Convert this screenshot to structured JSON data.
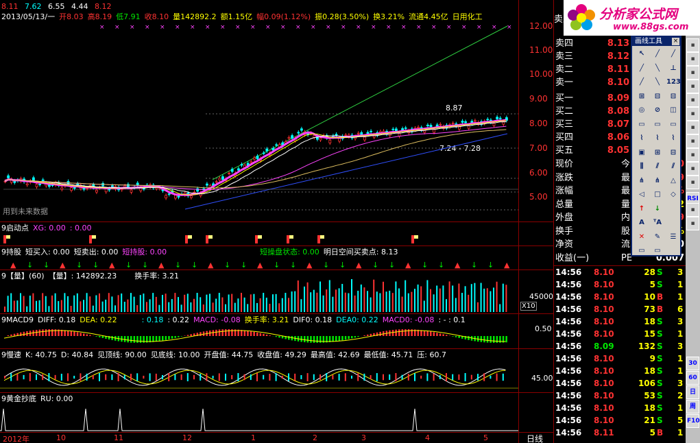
{
  "info_bar": {
    "date": "2013/05/13/一",
    "open": "开8.03",
    "high": "高8.19",
    "low": "低7.91",
    "close": "收8.10",
    "volume": "量142892.2",
    "amount": "额1.15亿",
    "range": "幅0.09(1.12%)",
    "amplitude": "振0.28(3.50%)",
    "turnover": "换3.21%",
    "float": "流通4.45亿",
    "industry": "日用化工"
  },
  "ma_row": {
    "v1": "8.11",
    "v2": "7.62",
    "v3": "6.55",
    "v4": "4.44",
    "v5": "8.12"
  },
  "price_axis": [
    "12.00",
    "11.00",
    "10.00",
    "9.00",
    "8.00",
    "7.00",
    "6.00",
    "5.00"
  ],
  "main_chart": {
    "warn": "用到未来数据",
    "high_label": "8.87",
    "range_label": "7.24 - 7.28"
  },
  "panels": {
    "p1": {
      "title": "9启动点",
      "a": "XG: 0.00",
      "b": ": 0.00"
    },
    "p2": {
      "title": "9持股",
      "a": "短买入: 0.00",
      "b": "短卖出: 0.00",
      "c": "短持股: 0.00",
      "d": "短操盘状态: 0.00",
      "e": "明日空间买卖点: 8.13"
    },
    "p3": {
      "title": "9【量】(60)",
      "a": "【量】: 142892.23",
      "b": "换手率: 3.21",
      "axis": "45000",
      "x": "X10"
    },
    "p4": {
      "title": "9MACD9",
      "a": "DIFF: 0.18",
      "b": "DEA: 0.22",
      "c": ": 0.18",
      "d": ": 0.22",
      "e": "MACD: -0.08",
      "f": "换手率: 3.21",
      "g": "DIF0: 0.18",
      "h": "DEA0: 0.22",
      "i": "MACD0: -0.08",
      "j": ": - : 0.1",
      "axis": "0.50"
    },
    "p5": {
      "title": "9慢速",
      "a": "K: 40.75",
      "b": "D: 40.84",
      "c": "见顶线: 90.00",
      "d": "见底线: 10.00",
      "e": "开盘值: 44.75",
      "f": "收盘值: 49.29",
      "g": "最高值: 42.69",
      "h": "最低值: 45.71",
      "i": "压: 60.7",
      "axis": "45.00"
    },
    "p6": {
      "title": "9黄金抄底",
      "a": "RU: 0.00"
    }
  },
  "time_axis": [
    "2012年",
    "10",
    "11",
    "12",
    "1",
    "2",
    "3",
    "4",
    "5"
  ],
  "period": "日线",
  "orderbook": {
    "asks": [
      [
        "卖五",
        ""
      ],
      [
        "卖四",
        "8.13"
      ],
      [
        "卖三",
        "8.12"
      ],
      [
        "卖二",
        "8.11"
      ],
      [
        "卖一",
        "8.10"
      ]
    ],
    "bids": [
      [
        "买一",
        "8.09"
      ],
      [
        "买二",
        "8.08"
      ],
      [
        "买三",
        "8.07"
      ],
      [
        "买四",
        "8.06"
      ],
      [
        "买五",
        "8.05"
      ]
    ],
    "stats": [
      [
        "现价",
        "8.10",
        "今"
      ],
      [
        "涨跌",
        "0.09",
        "最"
      ],
      [
        "涨幅",
        "1.12%",
        "最"
      ],
      [
        "总量",
        "142892",
        "量"
      ],
      [
        "外盘",
        "73409",
        "内"
      ],
      [
        "换手",
        "3.21%",
        "股"
      ],
      [
        "净资",
        "2.30",
        "流"
      ],
      [
        "收益(一)",
        "0.007",
        "PE"
      ]
    ]
  },
  "ticks": [
    [
      "14:56",
      "8.10",
      "28",
      "S",
      "3"
    ],
    [
      "14:56",
      "8.10",
      "5",
      "S",
      "1"
    ],
    [
      "14:56",
      "8.10",
      "10",
      "B",
      "1"
    ],
    [
      "14:56",
      "8.10",
      "73",
      "B",
      "6"
    ],
    [
      "14:56",
      "8.10",
      "18",
      "S",
      "3"
    ],
    [
      "14:56",
      "8.10",
      "15",
      "S",
      "1"
    ],
    [
      "14:56",
      "8.09",
      "132",
      "S",
      "3"
    ],
    [
      "14:56",
      "8.10",
      "9",
      "S",
      "1"
    ],
    [
      "14:56",
      "8.10",
      "18",
      "S",
      "1"
    ],
    [
      "14:56",
      "8.10",
      "106",
      "S",
      "3"
    ],
    [
      "14:56",
      "8.10",
      "53",
      "S",
      "2"
    ],
    [
      "14:56",
      "8.10",
      "18",
      "S",
      "1"
    ],
    [
      "14:56",
      "8.10",
      "21",
      "S",
      "5"
    ],
    [
      "14:56",
      "8.11",
      "5",
      "B",
      "1"
    ]
  ],
  "logo": {
    "text": "分析家公式网",
    "url": "www.88gs.com"
  },
  "tool_window": {
    "title": "画线工具"
  },
  "right_strip": [
    "RSI",
    "30",
    "60",
    "日",
    "周",
    "F10"
  ],
  "colors": {
    "up": "#ff3232",
    "down": "#00e600",
    "border": "#8b0000"
  }
}
